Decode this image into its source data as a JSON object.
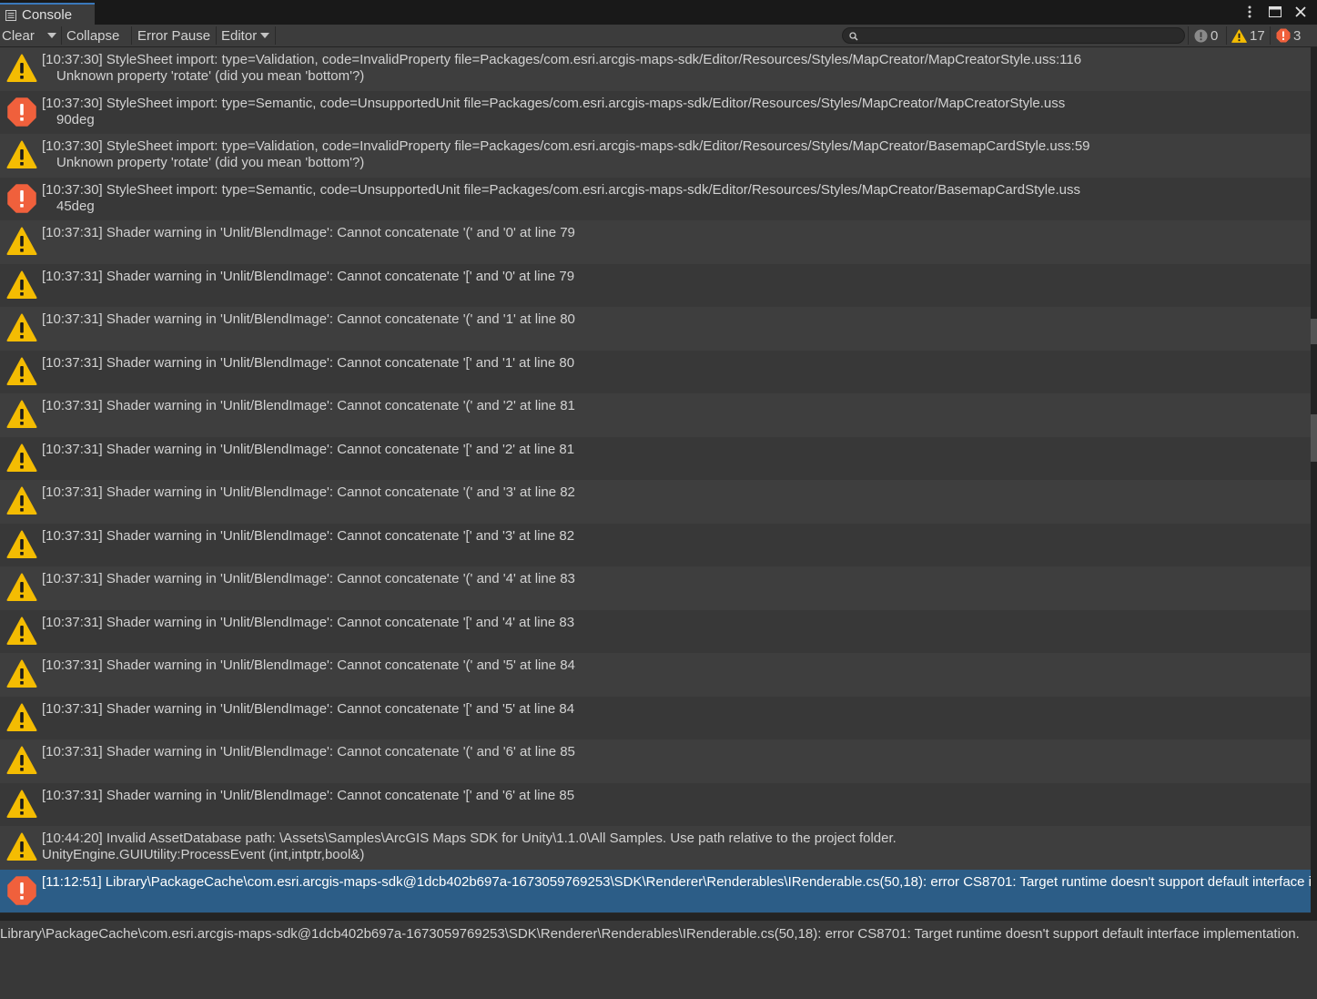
{
  "window": {
    "tab_label": "Console",
    "tab_icon": "list-icon",
    "menu_icon": "kebab-menu-icon",
    "maximize_icon": "maximize-icon",
    "close_icon": "close-icon"
  },
  "toolbar": {
    "clear_label": "Clear",
    "collapse_label": "Collapse",
    "error_pause_label": "Error Pause",
    "editor_label": "Editor",
    "search_value": "",
    "search_placeholder": "",
    "counts": {
      "info": "0",
      "warning": "17",
      "error": "3"
    }
  },
  "colors": {
    "warning": "#f4bc02",
    "error": "#f0603c",
    "info": "#9a9a9a",
    "selection": "#2c5d87"
  },
  "logs": [
    {
      "type": "warning",
      "line1": "[10:37:30] StyleSheet import: type=Validation, code=InvalidProperty file=Packages/com.esri.arcgis-maps-sdk/Editor/Resources/Styles/MapCreator/MapCreatorStyle.uss:116",
      "line2": "Unknown property 'rotate' (did you mean 'bottom'?)",
      "indent": true
    },
    {
      "type": "error",
      "line1": "[10:37:30] StyleSheet import: type=Semantic, code=UnsupportedUnit file=Packages/com.esri.arcgis-maps-sdk/Editor/Resources/Styles/MapCreator/MapCreatorStyle.uss",
      "line2": "90deg",
      "indent": true
    },
    {
      "type": "warning",
      "line1": "[10:37:30] StyleSheet import: type=Validation, code=InvalidProperty file=Packages/com.esri.arcgis-maps-sdk/Editor/Resources/Styles/MapCreator/BasemapCardStyle.uss:59",
      "line2": "Unknown property 'rotate' (did you mean 'bottom'?)",
      "indent": true
    },
    {
      "type": "error",
      "line1": "[10:37:30] StyleSheet import: type=Semantic, code=UnsupportedUnit file=Packages/com.esri.arcgis-maps-sdk/Editor/Resources/Styles/MapCreator/BasemapCardStyle.uss",
      "line2": "45deg",
      "indent": true
    },
    {
      "type": "warning",
      "line1": "[10:37:31] Shader warning in 'Unlit/BlendImage': Cannot concatenate '(' and '0' at line 79",
      "line2": "",
      "indent": true
    },
    {
      "type": "warning",
      "line1": "[10:37:31] Shader warning in 'Unlit/BlendImage': Cannot concatenate '[' and '0' at line 79",
      "line2": "",
      "indent": true
    },
    {
      "type": "warning",
      "line1": "[10:37:31] Shader warning in 'Unlit/BlendImage': Cannot concatenate '(' and '1' at line 80",
      "line2": "",
      "indent": true
    },
    {
      "type": "warning",
      "line1": "[10:37:31] Shader warning in 'Unlit/BlendImage': Cannot concatenate '[' and '1' at line 80",
      "line2": "",
      "indent": true
    },
    {
      "type": "warning",
      "line1": "[10:37:31] Shader warning in 'Unlit/BlendImage': Cannot concatenate '(' and '2' at line 81",
      "line2": "",
      "indent": true
    },
    {
      "type": "warning",
      "line1": "[10:37:31] Shader warning in 'Unlit/BlendImage': Cannot concatenate '[' and '2' at line 81",
      "line2": "",
      "indent": true
    },
    {
      "type": "warning",
      "line1": "[10:37:31] Shader warning in 'Unlit/BlendImage': Cannot concatenate '(' and '3' at line 82",
      "line2": "",
      "indent": true
    },
    {
      "type": "warning",
      "line1": "[10:37:31] Shader warning in 'Unlit/BlendImage': Cannot concatenate '[' and '3' at line 82",
      "line2": "",
      "indent": true
    },
    {
      "type": "warning",
      "line1": "[10:37:31] Shader warning in 'Unlit/BlendImage': Cannot concatenate '(' and '4' at line 83",
      "line2": "",
      "indent": true
    },
    {
      "type": "warning",
      "line1": "[10:37:31] Shader warning in 'Unlit/BlendImage': Cannot concatenate '[' and '4' at line 83",
      "line2": "",
      "indent": true
    },
    {
      "type": "warning",
      "line1": "[10:37:31] Shader warning in 'Unlit/BlendImage': Cannot concatenate '(' and '5' at line 84",
      "line2": "",
      "indent": true
    },
    {
      "type": "warning",
      "line1": "[10:37:31] Shader warning in 'Unlit/BlendImage': Cannot concatenate '[' and '5' at line 84",
      "line2": "",
      "indent": true
    },
    {
      "type": "warning",
      "line1": "[10:37:31] Shader warning in 'Unlit/BlendImage': Cannot concatenate '(' and '6' at line 85",
      "line2": "",
      "indent": true
    },
    {
      "type": "warning",
      "line1": "[10:37:31] Shader warning in 'Unlit/BlendImage': Cannot concatenate '[' and '6' at line 85",
      "line2": "",
      "indent": true
    },
    {
      "type": "warning",
      "line1": "[10:44:20] Invalid AssetDatabase path: \\Assets\\Samples\\ArcGIS Maps SDK for Unity\\1.1.0\\All Samples. Use path relative to the project folder.",
      "line2": "UnityEngine.GUIUtility:ProcessEvent (int,intptr,bool&)",
      "indent": false
    },
    {
      "type": "error",
      "line1": "[11:12:51] Library\\PackageCache\\com.esri.arcgis-maps-sdk@1dcb402b697a-1673059769253\\SDK\\Renderer\\Renderables\\IRenderable.cs(50,18): error CS8701: Target runtime doesn't support default interface implementation.",
      "line2": "",
      "indent": true,
      "selected": true
    }
  ],
  "detail": {
    "text": "Library\\PackageCache\\com.esri.arcgis-maps-sdk@1dcb402b697a-1673059769253\\SDK\\Renderer\\Renderables\\IRenderable.cs(50,18): error CS8701: Target runtime doesn't support default interface implementation."
  }
}
